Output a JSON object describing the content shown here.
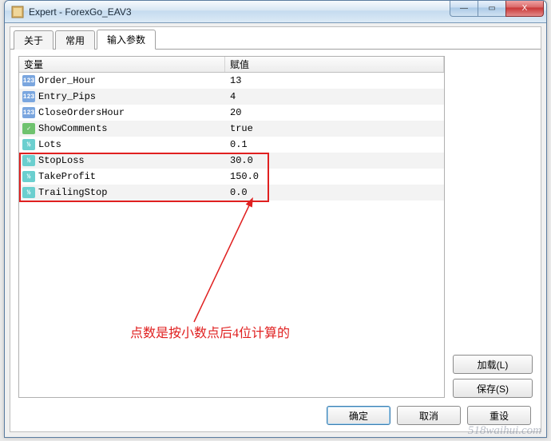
{
  "window": {
    "title": "Expert - ForexGo_EAV3",
    "min_label": "—",
    "max_label": "▭",
    "close_label": "X"
  },
  "tabs": [
    {
      "label": "关于",
      "active": false
    },
    {
      "label": "常用",
      "active": false
    },
    {
      "label": "输入参数",
      "active": true
    }
  ],
  "grid": {
    "header_var": "变量",
    "header_val": "赋值",
    "rows": [
      {
        "icon": "int",
        "name": "Order_Hour",
        "value": "13"
      },
      {
        "icon": "int",
        "name": "Entry_Pips",
        "value": "4"
      },
      {
        "icon": "int",
        "name": "CloseOrdersHour",
        "value": "20"
      },
      {
        "icon": "bool",
        "name": "ShowComments",
        "value": "true"
      },
      {
        "icon": "dbl",
        "name": "Lots",
        "value": "0.1"
      },
      {
        "icon": "dbl",
        "name": "StopLoss",
        "value": "30.0"
      },
      {
        "icon": "dbl",
        "name": "TakeProfit",
        "value": "150.0"
      },
      {
        "icon": "dbl",
        "name": "TrailingStop",
        "value": "0.0"
      }
    ]
  },
  "buttons": {
    "load": "加载(L)",
    "save": "保存(S)",
    "ok": "确定",
    "cancel": "取消",
    "reset": "重设"
  },
  "annotation": {
    "text": "点数是按小数点后4位计算的"
  },
  "watermark": "518waihui.com",
  "icon_text": {
    "int": "123",
    "bool": "✓",
    "dbl": "½"
  }
}
